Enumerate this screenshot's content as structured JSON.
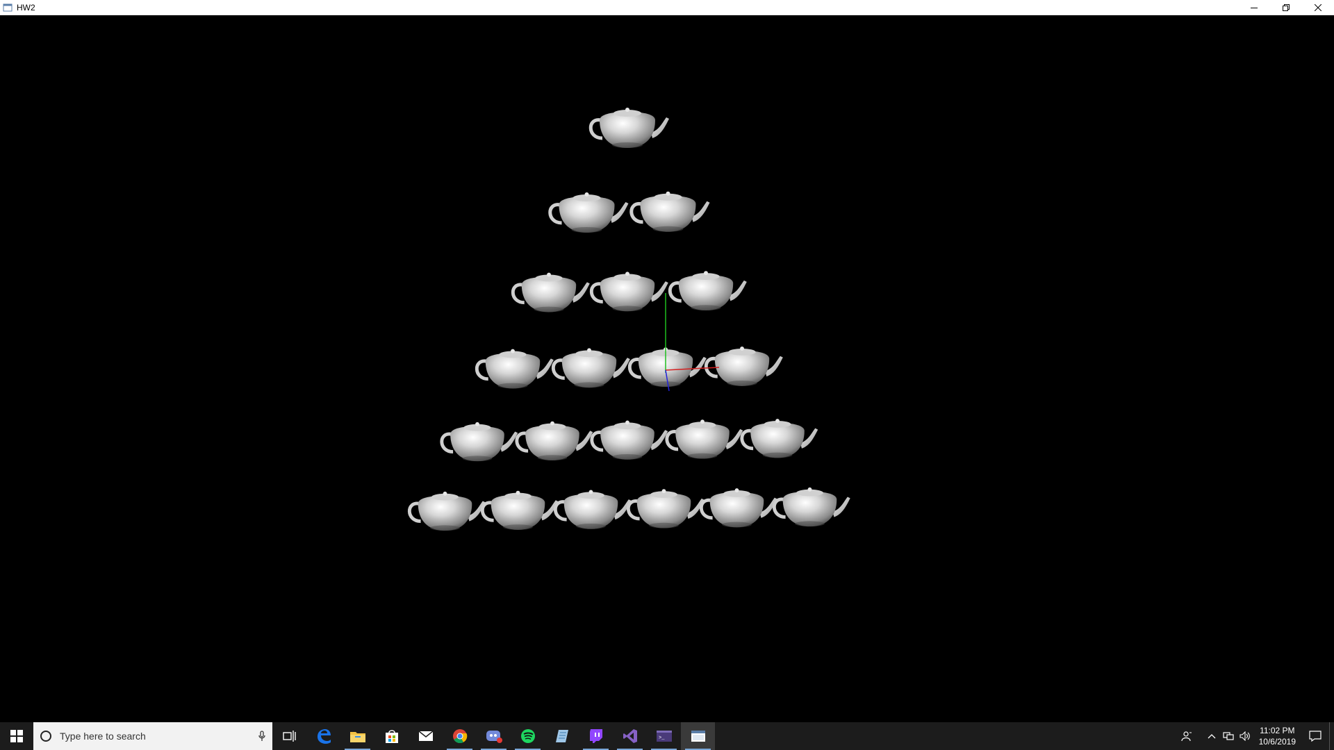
{
  "window": {
    "title": "HW2"
  },
  "scene": {
    "rows": [
      1,
      2,
      3,
      4,
      5,
      6
    ],
    "axis_colors": {
      "x": "#d42020",
      "y": "#1fbf1f",
      "z": "#2222dd"
    },
    "object_icon": "teapot-icon"
  },
  "taskbar": {
    "search_placeholder": "Type here to search",
    "apps": [
      {
        "name": "task-view-icon"
      },
      {
        "name": "edge-icon"
      },
      {
        "name": "file-explorer-icon"
      },
      {
        "name": "store-icon"
      },
      {
        "name": "mail-icon"
      },
      {
        "name": "chrome-icon"
      },
      {
        "name": "discord-icon"
      },
      {
        "name": "spotify-icon"
      },
      {
        "name": "notes-icon"
      },
      {
        "name": "twitch-icon"
      },
      {
        "name": "visual-studio-icon"
      },
      {
        "name": "terminal-icon"
      },
      {
        "name": "hw2-app-icon"
      }
    ],
    "clock": {
      "time": "11:02 PM",
      "date": "10/6/2019"
    }
  }
}
